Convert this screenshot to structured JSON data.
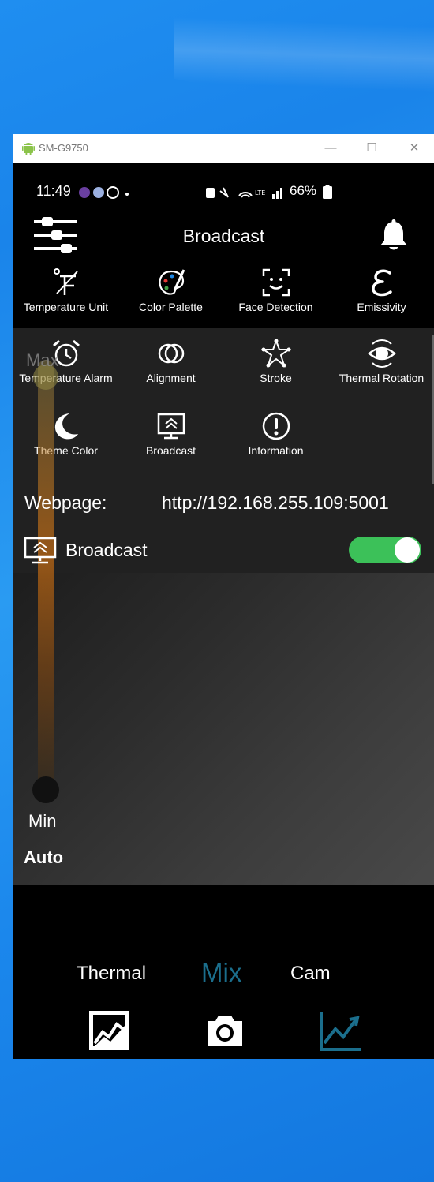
{
  "window": {
    "title": "SM-G9750",
    "minimize": "—",
    "maximize": "☐",
    "close": "✕"
  },
  "status_bar": {
    "time": "11:49",
    "battery": "66%"
  },
  "header": {
    "title": "Broadcast"
  },
  "menu": [
    {
      "label": "Temperature Unit",
      "icon": "temperature-unit-icon"
    },
    {
      "label": "Color Palette",
      "icon": "palette-icon"
    },
    {
      "label": "Face Detection",
      "icon": "face-detection-icon"
    },
    {
      "label": "Emissivity",
      "icon": "emissivity-icon"
    },
    {
      "label": "Temperature Alarm",
      "icon": "alarm-icon"
    },
    {
      "label": "Alignment",
      "icon": "alignment-icon"
    },
    {
      "label": "Stroke",
      "icon": "stroke-icon"
    },
    {
      "label": "Thermal Rotation",
      "icon": "rotation-icon"
    },
    {
      "label": "Theme Color",
      "icon": "moon-icon"
    },
    {
      "label": "Broadcast",
      "icon": "broadcast-icon"
    },
    {
      "label": "Information",
      "icon": "info-icon"
    }
  ],
  "webpage": {
    "label": "Webpage:",
    "url": "http://192.168.255.109:5001"
  },
  "broadcast": {
    "label": "Broadcast",
    "enabled": true,
    "toggle_color": "#3cc159"
  },
  "range": {
    "max": "Max",
    "min": "Min",
    "auto": "Auto"
  },
  "modes": {
    "thermal": "Thermal",
    "mix": "Mix",
    "cam": "Cam",
    "active_color": "#1b6e8c"
  }
}
